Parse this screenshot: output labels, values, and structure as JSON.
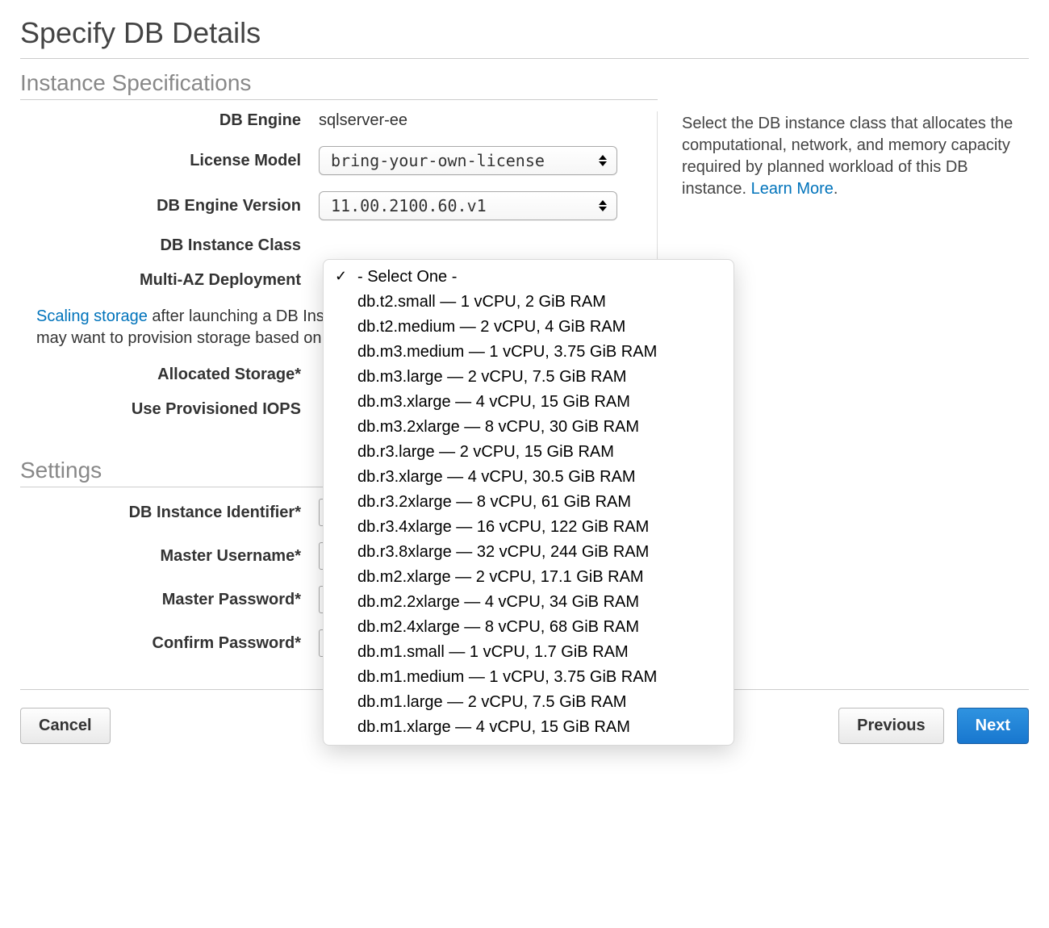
{
  "page": {
    "title": "Specify DB Details"
  },
  "instance_spec": {
    "section_title": "Instance Specifications",
    "labels": {
      "db_engine": "DB Engine",
      "license_model": "License Model",
      "db_engine_version": "DB Engine Version",
      "db_instance_class": "DB Instance Class",
      "multi_az": "Multi-AZ Deployment",
      "allocated_storage": "Allocated Storage*",
      "use_piops": "Use Provisioned IOPS"
    },
    "values": {
      "db_engine": "sqlserver-ee",
      "license_model": "bring-your-own-license",
      "db_engine_version": "11.00.2100.60.v1"
    },
    "help": {
      "scaling_link": "Scaling storage",
      "scaling_text_a": " after launching a DB Instance running Microsoft SQL Server. You may want to provision storage based on anticipated future storage growth.",
      "scaling_visible_text": " after launching a DB In… Server. You may want to provision sto… growth."
    }
  },
  "tip": {
    "text_a": "Select the DB instance class that allocates the computational, network, and memory capacity required by planned workload of this DB instance. ",
    "learn_more": "Learn More",
    "text_b": "."
  },
  "dropdown": {
    "selected": "- Select One -",
    "options": [
      "- Select One -",
      "db.t2.small — 1 vCPU, 2 GiB RAM",
      "db.t2.medium — 2 vCPU, 4 GiB RAM",
      "db.m3.medium — 1 vCPU, 3.75 GiB RAM",
      "db.m3.large — 2 vCPU, 7.5 GiB RAM",
      "db.m3.xlarge — 4 vCPU, 15 GiB RAM",
      "db.m3.2xlarge — 8 vCPU, 30 GiB RAM",
      "db.r3.large — 2 vCPU, 15 GiB RAM",
      "db.r3.xlarge — 4 vCPU, 30.5 GiB RAM",
      "db.r3.2xlarge — 8 vCPU, 61 GiB RAM",
      "db.r3.4xlarge — 16 vCPU, 122 GiB RAM",
      "db.r3.8xlarge — 32 vCPU, 244 GiB RAM",
      "db.m2.xlarge — 2 vCPU, 17.1 GiB RAM",
      "db.m2.2xlarge — 4 vCPU, 34 GiB RAM",
      "db.m2.4xlarge — 8 vCPU, 68 GiB RAM",
      "db.m1.small — 1 vCPU, 1.7 GiB RAM",
      "db.m1.medium — 1 vCPU, 3.75 GiB RAM",
      "db.m1.large — 2 vCPU, 7.5 GiB RAM",
      "db.m1.xlarge — 4 vCPU, 15 GiB RAM"
    ]
  },
  "settings": {
    "section_title": "Settings",
    "labels": {
      "identifier": "DB Instance Identifier*",
      "master_user": "Master Username*",
      "master_pass": "Master Password*",
      "confirm_pass": "Confirm Password*"
    }
  },
  "footer": {
    "cancel": "Cancel",
    "previous": "Previous",
    "next": "Next"
  }
}
